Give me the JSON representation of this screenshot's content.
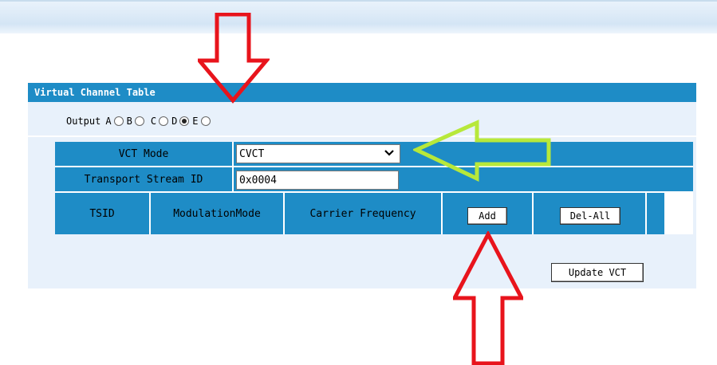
{
  "panel": {
    "title": "Virtual Channel Table",
    "output": {
      "label": "Output",
      "options": [
        {
          "label": "A",
          "checked": false
        },
        {
          "label": "B",
          "checked": false
        },
        {
          "label": "C",
          "checked": false
        },
        {
          "label": "D",
          "checked": true
        },
        {
          "label": "E",
          "checked": false
        }
      ]
    },
    "vct_mode": {
      "label": "VCT Mode",
      "value": "CVCT"
    },
    "ts_id": {
      "label": "Transport Stream ID",
      "value": "0x0004"
    },
    "columns": {
      "tsid": "TSID",
      "modulation": "ModulationMode",
      "carrier": "Carrier Frequency"
    },
    "buttons": {
      "add": "Add",
      "del_all": "Del-All",
      "update": "Update VCT"
    }
  },
  "colors": {
    "header_blue": "#1e8cc6",
    "panel_bg": "#e8f1fb",
    "arrow_red": "#e8141c",
    "arrow_green": "#b7e83a"
  }
}
